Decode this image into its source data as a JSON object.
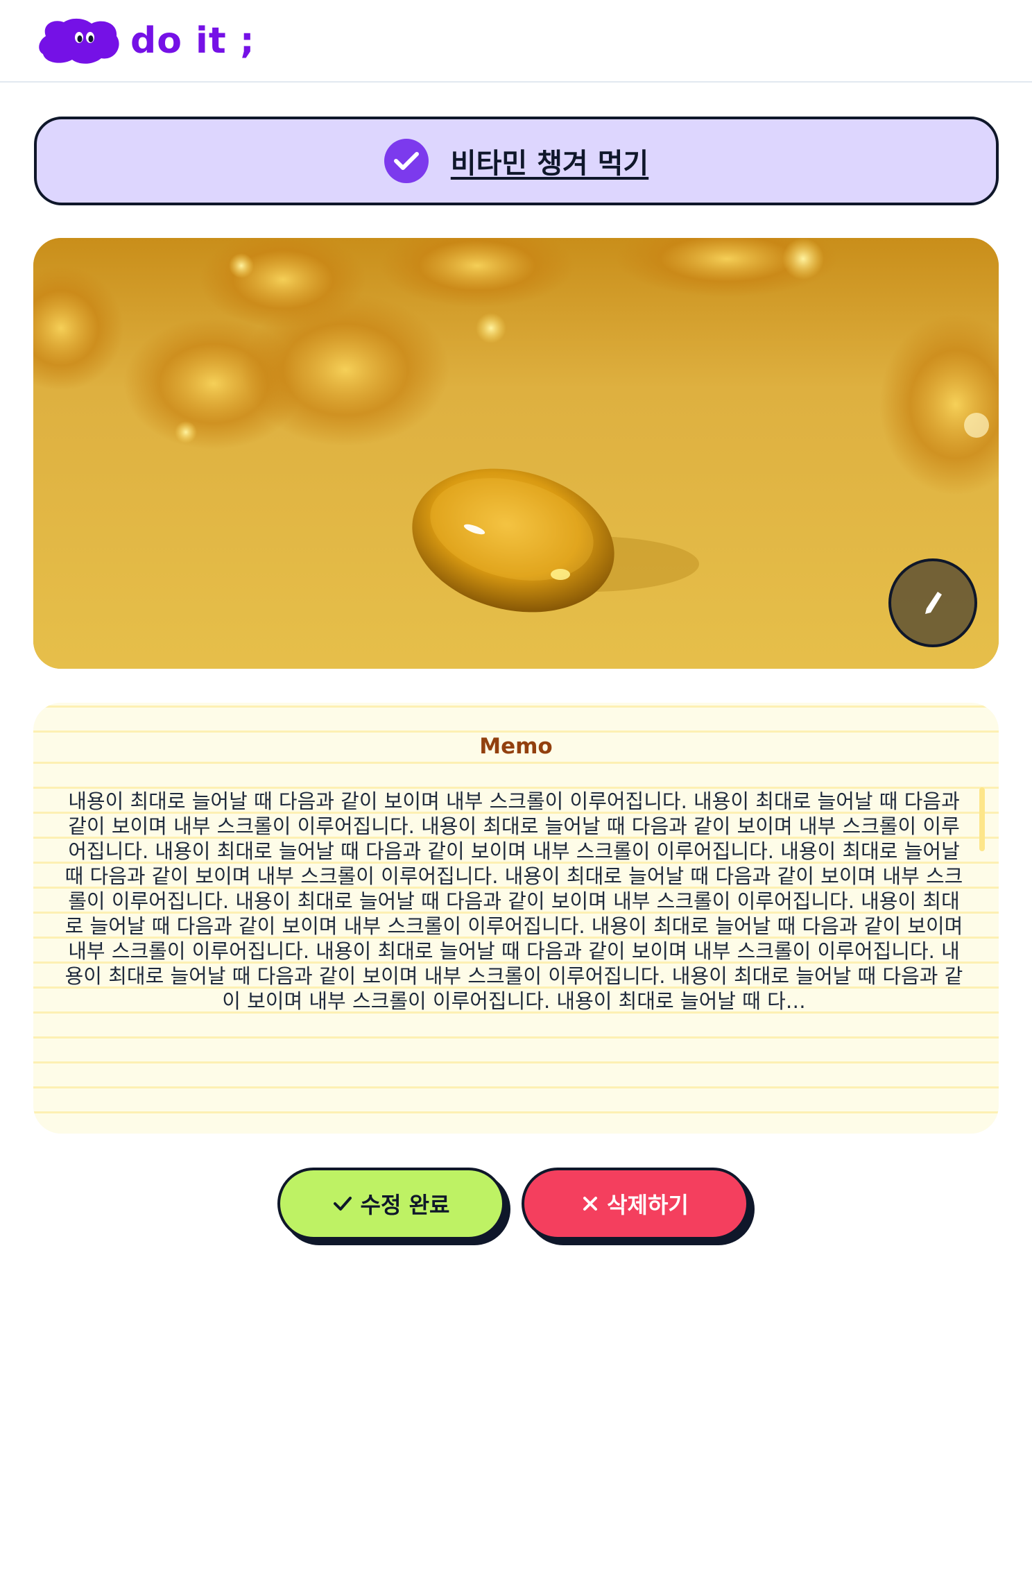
{
  "app": {
    "logo_text": "do it ;",
    "brand_color": "#7511e6"
  },
  "todo": {
    "title": "비타민 챙겨 먹기",
    "completed": true,
    "check_color": "#7c3aed"
  },
  "image": {
    "edit_icon": "pencil-icon"
  },
  "memo": {
    "title": "Memo",
    "content": "내용이 최대로 늘어날 때 다음과 같이 보이며 내부 스크롤이 이루어집니다. 내용이 최대로 늘어날 때 다음과 같이 보이며 내부 스크롤이 이루어집니다. 내용이 최대로 늘어날 때 다음과 같이 보이며 내부 스크롤이 이루어집니다. 내용이 최대로 늘어날 때 다음과 같이 보이며 내부 스크롤이 이루어집니다. 내용이 최대로 늘어날 때 다음과 같이 보이며 내부 스크롤이 이루어집니다. 내용이 최대로 늘어날 때 다음과 같이 보이며 내부 스크롤이 이루어집니다. 내용이 최대로 늘어날 때 다음과 같이 보이며 내부 스크롤이 이루어집니다. 내용이 최대로 늘어날 때 다음과 같이 보이며 내부 스크롤이 이루어집니다. 내용이 최대로 늘어날 때 다음과 같이 보이며 내부 스크롤이 이루어집니다. 내용이 최대로 늘어날 때 다음과 같이 보이며 내부 스크롤이 이루어집니다. 내용이 최대로 늘어날 때 다음과 같이 보이며 내부 스크롤이 이루어집니다. 내용이 최대로 늘어날 때 다음과 같이 보이며 내부 스크롤이 이루어집니다. 내용이 최대로 늘어날 때 다…"
  },
  "actions": {
    "save_label": "수정 완료",
    "save_icon": "check-icon",
    "save_color": "#bef264",
    "delete_label": "삭제하기",
    "delete_icon": "x-icon",
    "delete_color": "#f43f5e"
  }
}
